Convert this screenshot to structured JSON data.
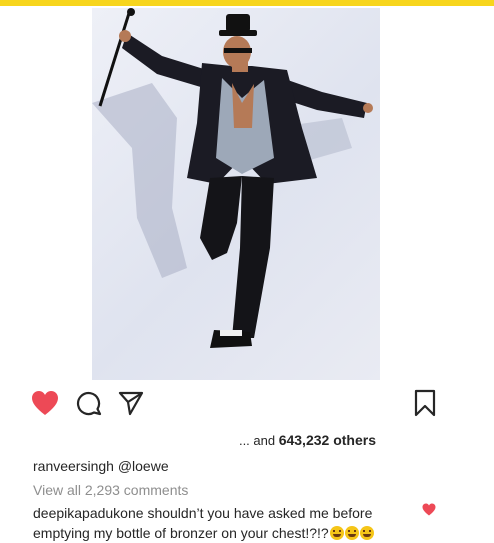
{
  "colors": {
    "top_bar": "#f7d51d",
    "like_red": "#ed4956",
    "muted": "#8e8e8e",
    "text": "#262626"
  },
  "actions": {
    "like_icon": "heart-filled-icon",
    "comment_icon": "comment-bubble-icon",
    "share_icon": "paper-plane-icon",
    "save_icon": "bookmark-icon"
  },
  "likes": {
    "prefix": "... and ",
    "count": "643,232",
    "suffix": " others"
  },
  "caption": {
    "username": "ranveersingh",
    "text": "@loewe"
  },
  "view_all_comments": "View all 2,293 comments",
  "comment": {
    "username": "deepikapadukone",
    "text": "shouldn’t you have asked me before emptying my bottle of bronzer on your chest!?!?",
    "emojis": [
      "rolling-laughing-emoji",
      "squinting-tongue-emoji",
      "zany-face-emoji"
    ]
  }
}
